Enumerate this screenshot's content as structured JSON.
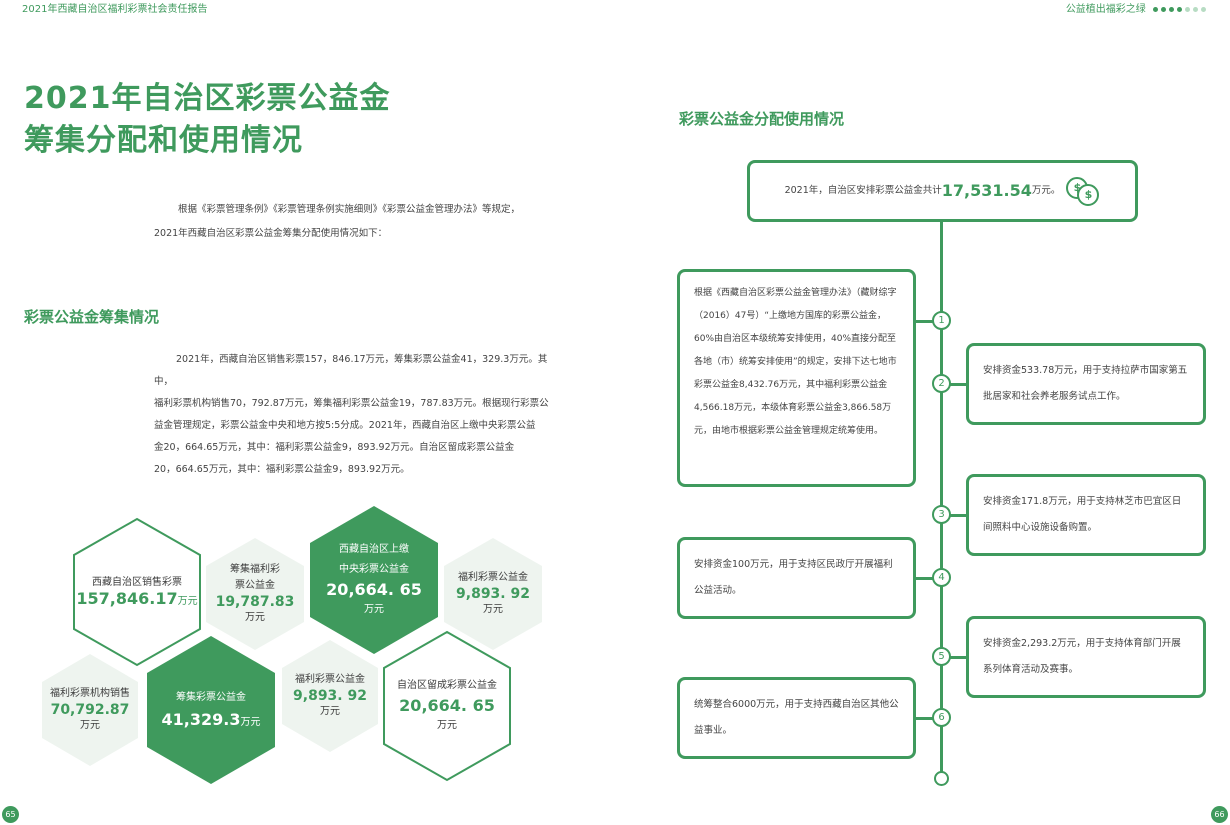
{
  "header": {
    "left": "2021年西藏自治区福利彩票社会责任报告",
    "right": "公益植出福彩之绿"
  },
  "title": {
    "line1": "2021年自治区彩票公益金",
    "line2": "筹集分配和使用情况"
  },
  "intro": {
    "line1": "根据《彩票管理条例》《彩票管理条例实施细则》《彩票公益金管理办法》等规定，",
    "line2": "2021年西藏自治区彩票公益金筹集分配使用情况如下："
  },
  "raising": {
    "title": "彩票公益金筹集情况",
    "lines": [
      "2021年，西藏自治区销售彩票157，846.17万元，筹集彩票公益金41，329.3万元。其中，",
      "福利彩票机构销售70，792.87万元，筹集福利彩票公益金19，787.83万元。根据现行彩票公",
      "益金管理规定，彩票公益金中央和地方按5:5分成。2021年，西藏自治区上缴中央彩票公益",
      "金20，664.65万元，其中：福利彩票公益金9，893.92万元。自治区留成彩票公益金",
      "20，664.65万元，其中：福利彩票公益金9，893.92万元。"
    ]
  },
  "hexes": {
    "h1": {
      "label": "西藏自治区销售彩票",
      "value": "157,846.17",
      "unit": "万元"
    },
    "h2": {
      "label1": "筹集福利彩",
      "label2": "票公益金",
      "value": "19,787.83",
      "unit": "万元"
    },
    "h3": {
      "label1": "西藏自治区上缴",
      "label2": "中央彩票公益金",
      "value": "20,664. 65",
      "unit": "万元"
    },
    "h4": {
      "label": "福利彩票公益金",
      "value": "9,893. 92",
      "unit": "万元"
    },
    "h5": {
      "label": "福利彩票机构销售",
      "value": "70,792.87",
      "unit": "万元"
    },
    "h6": {
      "label": "筹集彩票公益金",
      "value": "41,329.3",
      "unit": "万元"
    },
    "h7": {
      "label": "福利彩票公益金",
      "value": "9,893. 92",
      "unit": "万元"
    },
    "h8": {
      "label": "自治区留成彩票公益金",
      "value": "20,664. 65",
      "unit": "万元"
    }
  },
  "allocation": {
    "title": "彩票公益金分配使用情况",
    "top_prefix": "2021年，自治区安排彩票公益金共计",
    "top_value": "17,531.54",
    "top_suffix": "万元。",
    "icon_symbol": "$",
    "steps": [
      {
        "num": "1",
        "text": "根据《西藏自治区彩票公益金管理办法》（藏财综字（2016）47号）“上缴地方国库的彩票公益金，60%由自治区本级统筹安排使用，40%直接分配至各地（市）统筹安排使用”的规定，安排下达七地市彩票公益金8,432.76万元，其中福利彩票公益金4,566.18万元，本级体育彩票公益金3,866.58万元，由地市根据彩票公益金管理规定统筹使用。"
      },
      {
        "num": "2",
        "text": "安排资金533.78万元，用于支持拉萨市国家第五批居家和社会养老服务试点工作。"
      },
      {
        "num": "3",
        "text": "安排资金171.8万元，用于支持林芝市巴宜区日间照料中心设施设备购置。"
      },
      {
        "num": "4",
        "text": "安排资金100万元，用于支持区民政厅开展福利公益活动。"
      },
      {
        "num": "5",
        "text": "安排资金2,293.2万元，用于支持体育部门开展系列体育活动及赛事。"
      },
      {
        "num": "6",
        "text": "统筹整合6000万元，用于支持西藏自治区其他公益事业。"
      }
    ]
  },
  "pages": {
    "left": "65",
    "right": "66"
  },
  "colors": {
    "accent": "#3f9a5d",
    "light_hex": "#eef4ef"
  }
}
